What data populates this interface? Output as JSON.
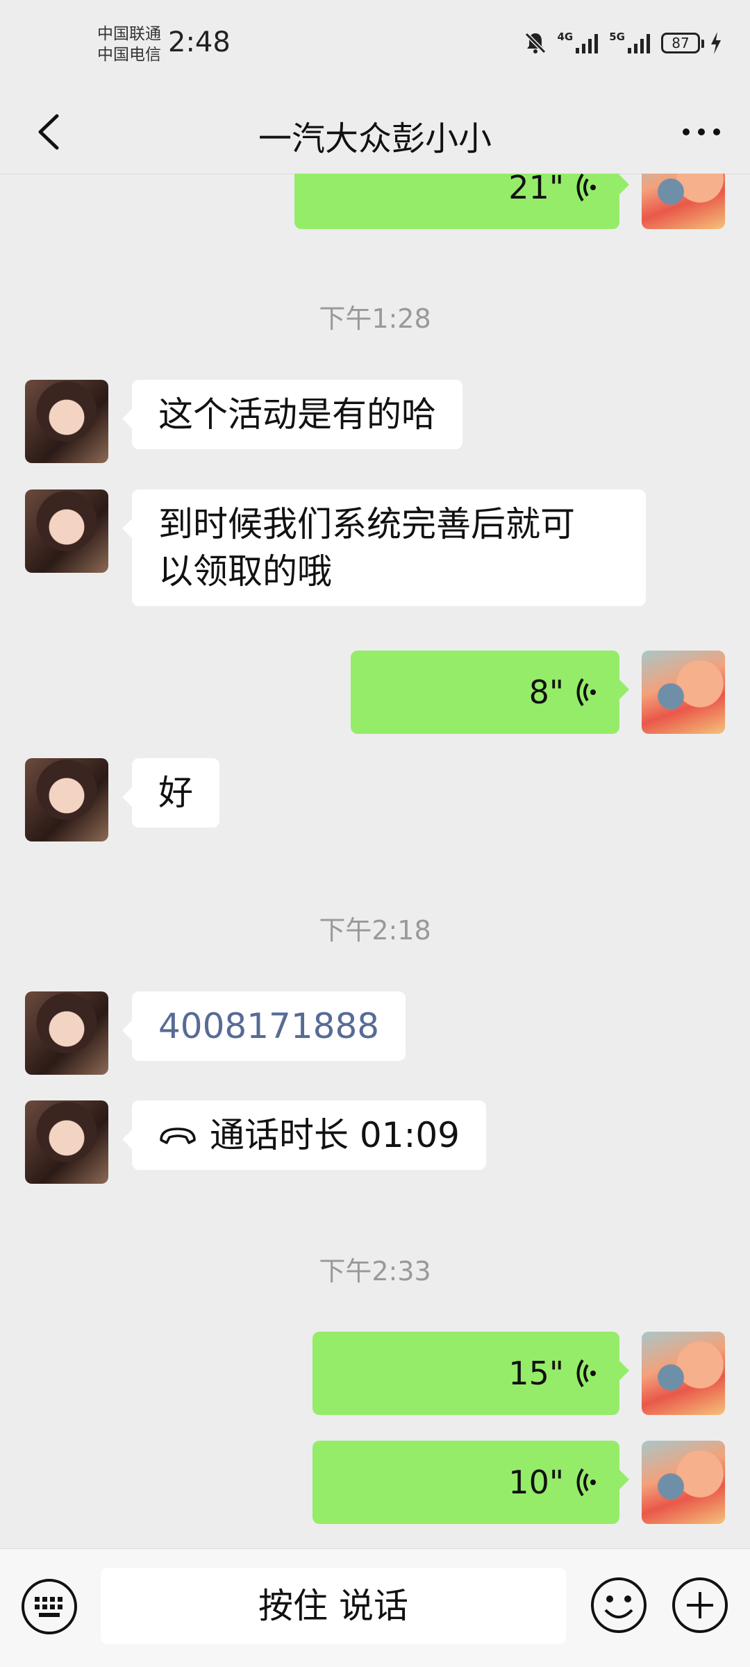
{
  "status_bar": {
    "carrier_1": "中国联通",
    "carrier_2": "中国电信",
    "time": "2:48",
    "network_1": "4G",
    "network_2": "5G",
    "battery": "87"
  },
  "header": {
    "title": "一汽大众彭小小",
    "back_icon": "chevron-left-icon",
    "more_icon": "more-icon"
  },
  "messages": [
    {
      "type": "voice",
      "side": "right",
      "duration": "21\""
    },
    {
      "type": "timestamp",
      "text": "下午1:28"
    },
    {
      "type": "text",
      "side": "left",
      "text": "这个活动是有的哈"
    },
    {
      "type": "text",
      "side": "left",
      "text_line1": "到时候我们系统完善后就可",
      "text_line2": "以领取的哦"
    },
    {
      "type": "voice",
      "side": "right",
      "duration": "8\""
    },
    {
      "type": "text",
      "side": "left",
      "text": "好"
    },
    {
      "type": "timestamp",
      "text": "下午2:18"
    },
    {
      "type": "phone",
      "side": "left",
      "text": "4008171888"
    },
    {
      "type": "call",
      "side": "left",
      "text": "通话时长 01:09"
    },
    {
      "type": "timestamp",
      "text": "下午2:33"
    },
    {
      "type": "voice",
      "side": "right",
      "duration": "15\""
    },
    {
      "type": "voice",
      "side": "right",
      "duration": "10\""
    }
  ],
  "input_bar": {
    "hold_to_talk": "按住 说话",
    "keyboard_icon": "keyboard-icon",
    "emoji_icon": "emoji-icon",
    "plus_icon": "plus-icon"
  },
  "colors": {
    "background": "#ededed",
    "sent_bubble": "#95ec69",
    "received_bubble": "#ffffff",
    "link": "#576b95"
  }
}
